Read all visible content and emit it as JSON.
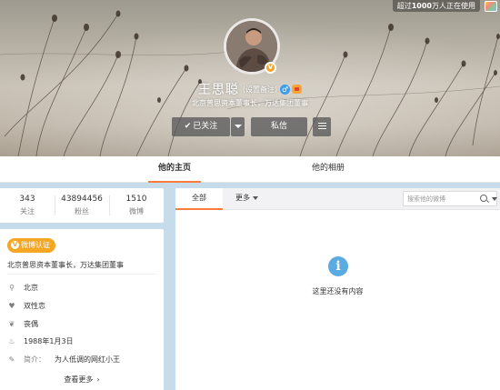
{
  "cover": {
    "online_badge_prefix": "超过",
    "online_badge_count": "1000",
    "online_badge_suffix": "万人正在使用"
  },
  "profile": {
    "name": "王思聪",
    "remark": "(设置备注)",
    "male_symbol": "♂",
    "bio": "北京普思资本董事长，万达集团董事",
    "avatar_badge": "V"
  },
  "actions": {
    "follow_label": "已关注",
    "message_label": "私信"
  },
  "tabs": {
    "home": "他的主页",
    "album": "他的相册"
  },
  "stats": [
    {
      "num": "343",
      "label": "关注"
    },
    {
      "num": "43894456",
      "label": "粉丝"
    },
    {
      "num": "1510",
      "label": "微博"
    }
  ],
  "info": {
    "verified_badge": "微博认证",
    "verified_desc": "北京普思资本董事长，万达集团董事",
    "location": "北京",
    "orientation": "双性恋",
    "relationship": "丧偶",
    "birthday": "1988年1月3日",
    "intro_label": "简介：",
    "intro": "为人低调的网红小王",
    "more_link": "查看更多"
  },
  "feed": {
    "tab_all": "全部",
    "tab_more": "更多",
    "search_placeholder": "搜索他的微博",
    "empty_text": "这里还没有内容"
  },
  "colors": {
    "accent": "#fa7d3c",
    "verified": "#f5a623",
    "info_blue": "#5cabe0",
    "page_bg": "#c7dcea"
  }
}
